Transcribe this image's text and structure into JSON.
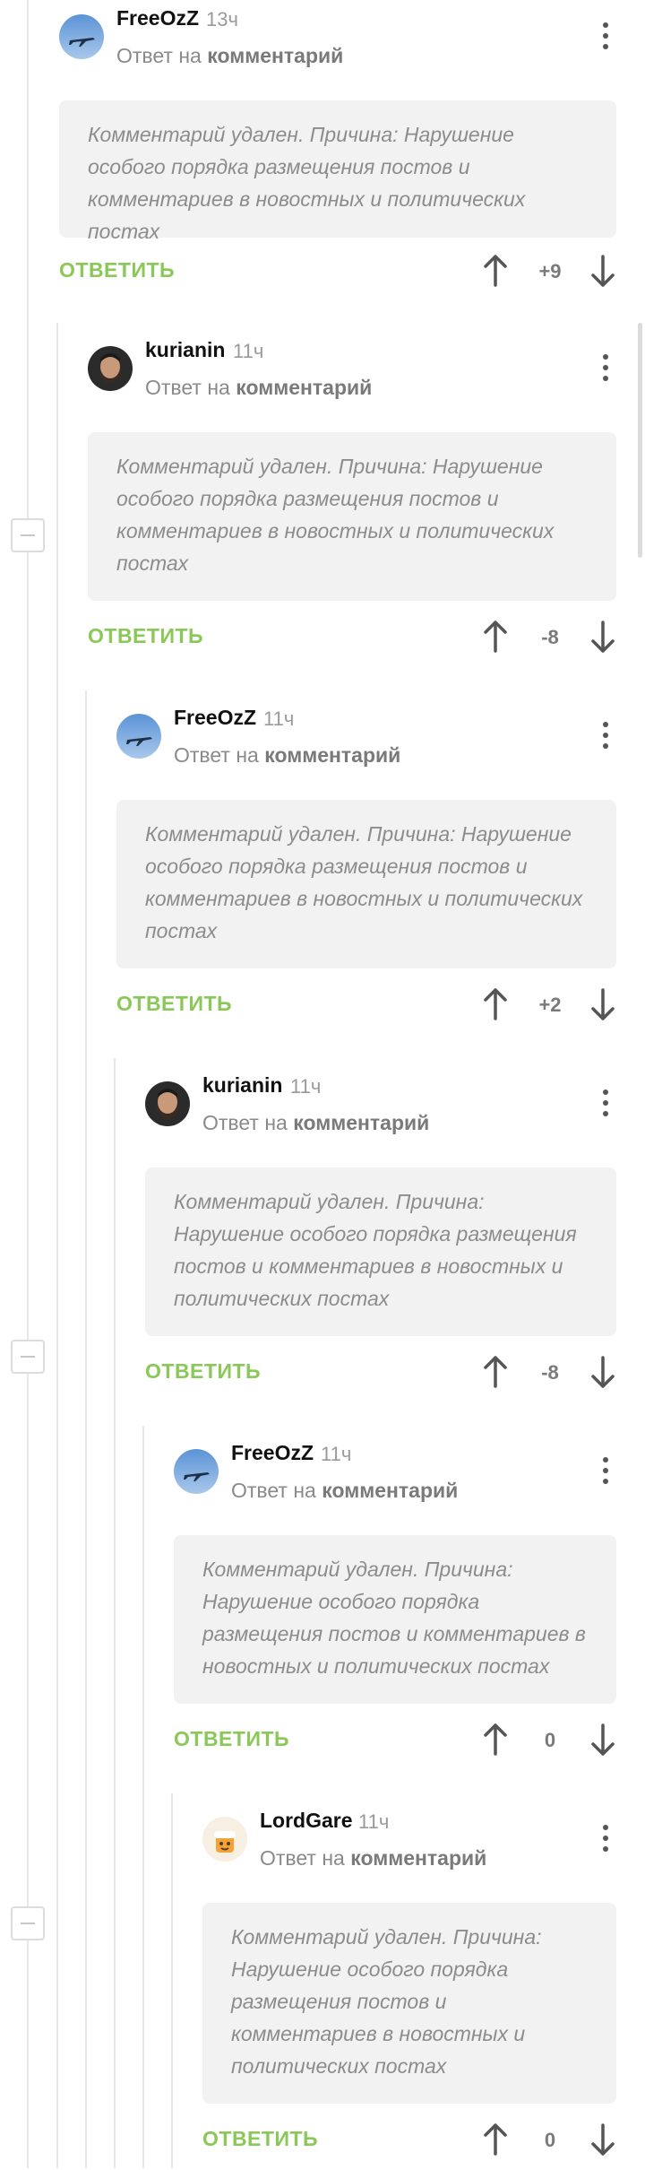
{
  "ui": {
    "reply_prefix": "Ответ на",
    "reply_target": "комментарий",
    "reply_button": "ОТВЕТИТЬ"
  },
  "colors": {
    "accent": "#8ac858",
    "card": "#f2f2f2",
    "muted": "#8c8c8c"
  },
  "comments": [
    {
      "author": "FreeOzZ",
      "time": "13ч",
      "text": "Комментарий удален. Причина: Нарушение особого порядка размещения постов и комментариев в новостных и политических постах",
      "rating": "+9",
      "avatar": "plane-avatar"
    },
    {
      "author": "kurianin",
      "time": "11ч",
      "text": "Комментарий удален. Причина: Нарушение особого порядка размещения постов и комментариев в новостных и политических постах",
      "rating": "-8",
      "avatar": "bearded-man-avatar"
    },
    {
      "author": "FreeOzZ",
      "time": "11ч",
      "text": "Комментарий удален. Причина: Нарушение особого порядка размещения постов и комментариев в новостных и политических постах",
      "rating": "+2",
      "avatar": "plane-avatar"
    },
    {
      "author": "kurianin",
      "time": "11ч",
      "text": "Комментарий удален. Причина: Нарушение особого порядка размещения постов и комментариев в новостных и политических постах",
      "rating": "-8",
      "avatar": "bearded-man-avatar"
    },
    {
      "author": "FreeOzZ",
      "time": "11ч",
      "text": "Комментарий удален. Причина: Нарушение особого порядка размещения постов и комментариев в новостных и политических постах",
      "rating": "0",
      "avatar": "plane-avatar"
    },
    {
      "author": "LordGare",
      "time": "11ч",
      "text": "Комментарий удален. Причина: Нарушение особого порядка размещения постов и комментариев в новостных и политических постах",
      "rating": "0",
      "avatar": "cartoon-avatar"
    }
  ]
}
